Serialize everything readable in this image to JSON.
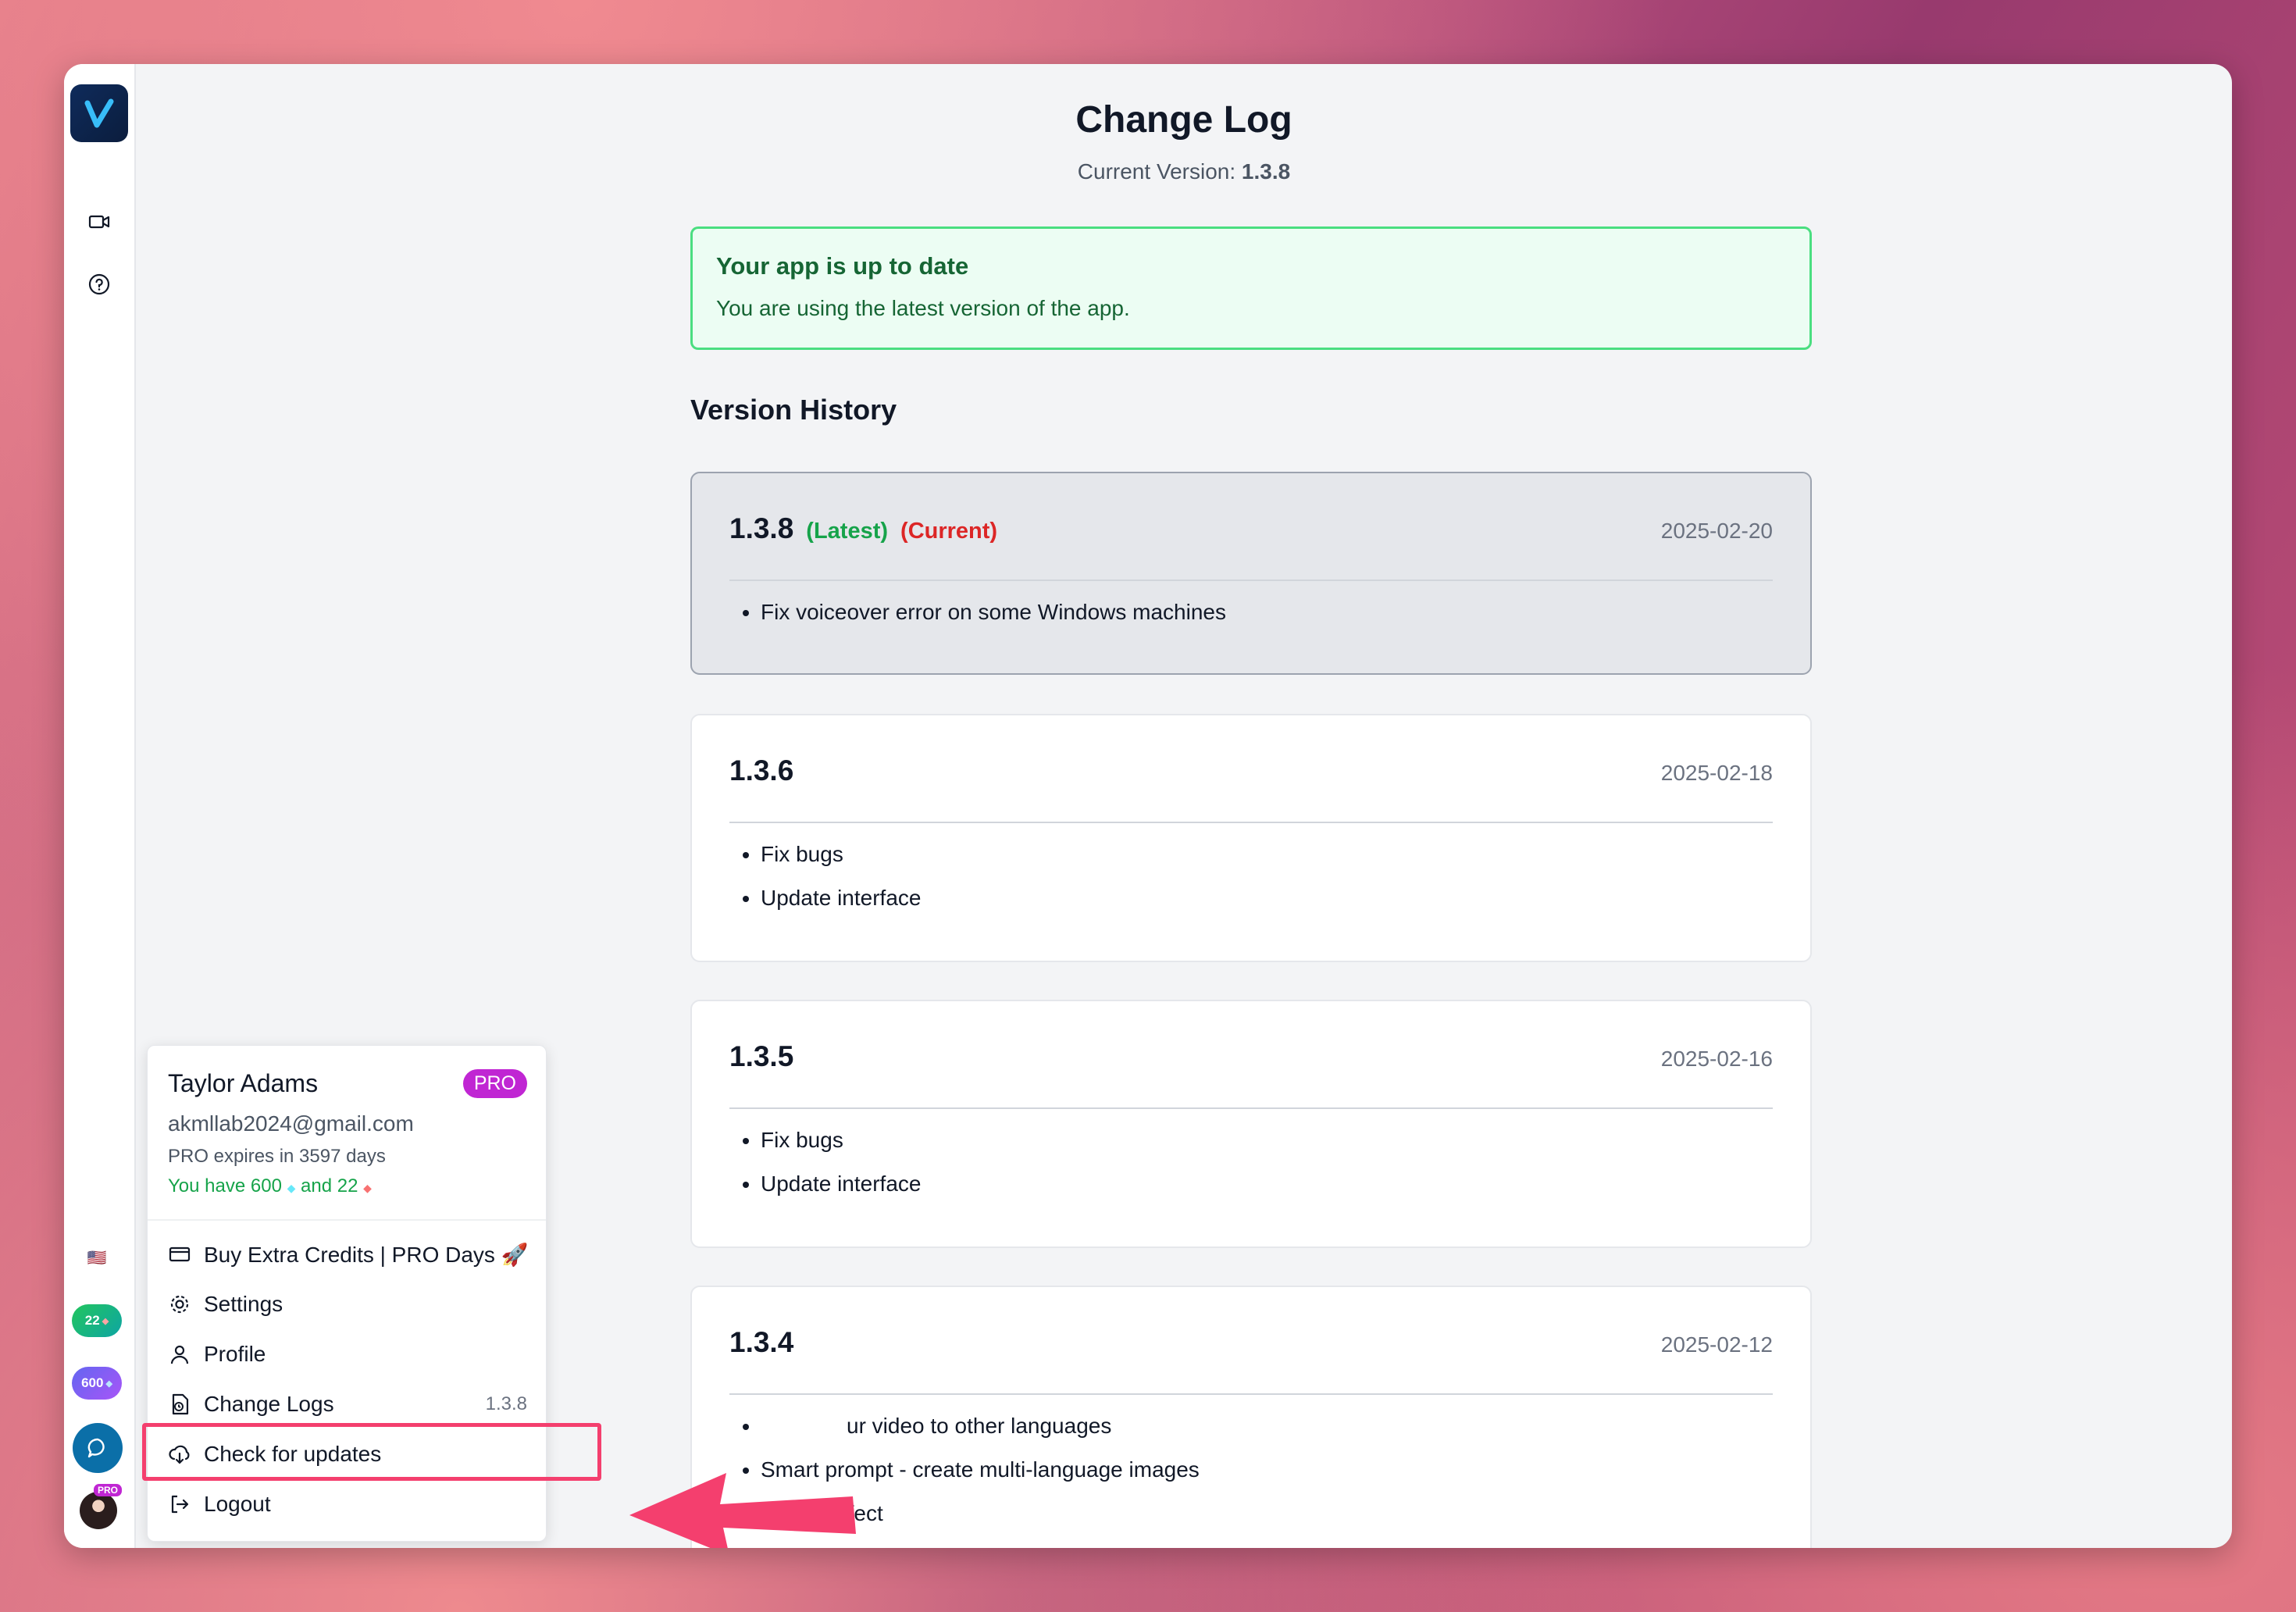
{
  "page": {
    "title": "Change Log",
    "current_version_label": "Current Version:",
    "current_version": "1.3.8"
  },
  "status": {
    "heading": "Your app is up to date",
    "message": "You are using the latest version of the app."
  },
  "history": {
    "heading": "Version History",
    "versions": [
      {
        "version": "1.3.8",
        "latest": "(Latest)",
        "current": "(Current)",
        "date": "2025-02-20",
        "notes": [
          "Fix voiceover error on some Windows machines"
        ]
      },
      {
        "version": "1.3.6",
        "date": "2025-02-18",
        "notes": [
          "Fix bugs",
          "Update interface"
        ]
      },
      {
        "version": "1.3.5",
        "date": "2025-02-16",
        "notes": [
          "Fix bugs",
          "Update interface"
        ]
      },
      {
        "version": "1.3.4",
        "date": "2025-02-12",
        "notes": [
          "ur video to other languages",
          "Smart prompt - create multi-language images",
          "Sound effect"
        ]
      }
    ]
  },
  "user": {
    "name": "Taylor Adams",
    "badge": "PRO",
    "email": "akmllab2024@gmail.com",
    "expires": "PRO expires in 3597 days",
    "credits_prefix": "You have 600",
    "credits_mid": "and 22"
  },
  "menu": {
    "buy": "Buy Extra Credits | PRO Days 🚀",
    "settings": "Settings",
    "profile": "Profile",
    "changelogs": "Change Logs",
    "changelogs_version": "1.3.8",
    "check_updates": "Check for updates",
    "logout": "Logout"
  },
  "rail": {
    "gems_count": "22",
    "credits_count": "600",
    "avatar_badge": "PRO",
    "flag": "🇺🇸"
  },
  "colors": {
    "accent_green": "#16a34a",
    "accent_red": "#dc2626",
    "pro": "#c026d3",
    "highlight": "#f43f6e"
  }
}
